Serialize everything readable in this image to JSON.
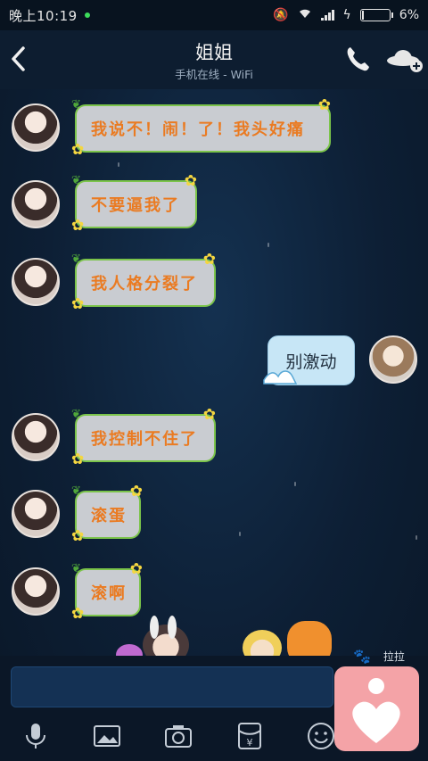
{
  "status_bar": {
    "time": "晚上10:19",
    "battery_percent": "6%",
    "battery_level": 0.06
  },
  "header": {
    "title": "姐姐",
    "subtitle": "手机在线 - WiFi",
    "icons": {
      "back": "back-arrow-icon",
      "call": "phone-icon",
      "more": "ufo-plus-icon"
    }
  },
  "messages": [
    {
      "side": "left",
      "text": "我说不！闹！了！我头好痛"
    },
    {
      "side": "left",
      "text": "不要逼我了"
    },
    {
      "side": "left",
      "text": "我人格分裂了"
    },
    {
      "side": "right",
      "text": "别激动"
    },
    {
      "side": "left",
      "text": "我控制不住了"
    },
    {
      "side": "left",
      "text": "滚蛋"
    },
    {
      "side": "left",
      "text": "滚啊"
    }
  ],
  "lala": {
    "label": "拉拉"
  },
  "toolbar": {
    "icons": [
      "microphone-icon",
      "image-icon",
      "camera-icon",
      "red-packet-icon",
      "emoji-icon"
    ]
  },
  "colors": {
    "bubble_border": "#7bc44a",
    "bubble_text": "#ea7b22",
    "bubble_bg": "#c9ccd1",
    "my_bubble_bg": "#c7e6f6",
    "heart_card": "#f4a3a7"
  }
}
